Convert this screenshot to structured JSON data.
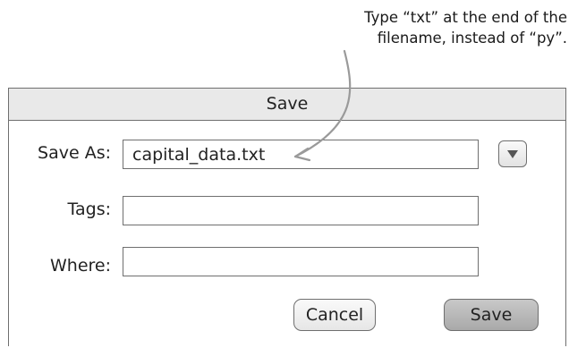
{
  "annotation": {
    "line1": "Type “txt” at the end of the",
    "line2": "filename, instead of “py”."
  },
  "dialog": {
    "title": "Save",
    "save_as": {
      "label": "Save As:",
      "value": "capital_data.txt"
    },
    "tags": {
      "label": "Tags:",
      "value": ""
    },
    "where": {
      "label": "Where:",
      "value": ""
    },
    "expand_icon": "chevron-down-icon",
    "cancel_label": "Cancel",
    "save_label": "Save"
  },
  "colors": {
    "title_bar_bg": "#e9e9e9",
    "border": "#6f6f6f",
    "save_button_bg": "#b8b8b8"
  }
}
